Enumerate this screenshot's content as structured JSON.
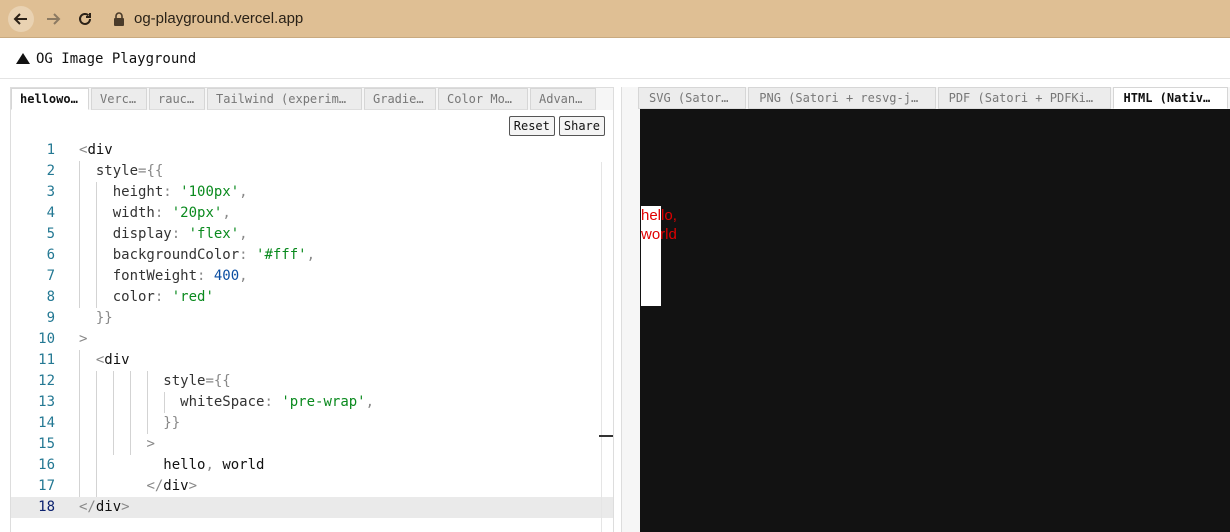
{
  "browser": {
    "url": "og-playground.vercel.app",
    "colors": {
      "bar": "#dfbf94"
    }
  },
  "app": {
    "title": "OG Image Playground"
  },
  "editor": {
    "tabs": [
      "hellowo…",
      "Verc…",
      "rauc…",
      "Tailwind (experime…",
      "Gradie…",
      "Color Mod…",
      "Advan…"
    ],
    "active_tab": 0,
    "buttons": {
      "reset": "Reset",
      "share": "Share"
    },
    "lines": [
      "1",
      "2",
      "3",
      "4",
      "5",
      "6",
      "7",
      "8",
      "9",
      "10",
      "11",
      "12",
      "13",
      "14",
      "15",
      "16",
      "17",
      "18"
    ],
    "code": {
      "l1_tag": "div",
      "l2_prop": "style",
      "l3_key": "height",
      "l3_val": "'100px'",
      "l4_key": "width",
      "l4_val": "'20px'",
      "l5_key": "display",
      "l5_val": "'flex'",
      "l6_key": "backgroundColor",
      "l6_val": "'#fff'",
      "l7_key": "fontWeight",
      "l7_val": "400",
      "l8_key": "color",
      "l8_val": "'red'",
      "l11_tag": "div",
      "l12_prop": "style",
      "l13_key": "whiteSpace",
      "l13_val": "'pre-wrap'",
      "l16_text1": "hello",
      "l16_text2": "world",
      "l17_tag": "div",
      "l18_tag": "div"
    },
    "current_line": 18
  },
  "preview": {
    "tabs": [
      "SVG (Satori)",
      "PNG (Satori + resvg-js)",
      "PDF (Satori + PDFKit)",
      "HTML (Native)"
    ],
    "active_tab": 3,
    "rendered_text": "hello, world",
    "colors": {
      "background": "#121212",
      "text": "#e00000"
    }
  }
}
